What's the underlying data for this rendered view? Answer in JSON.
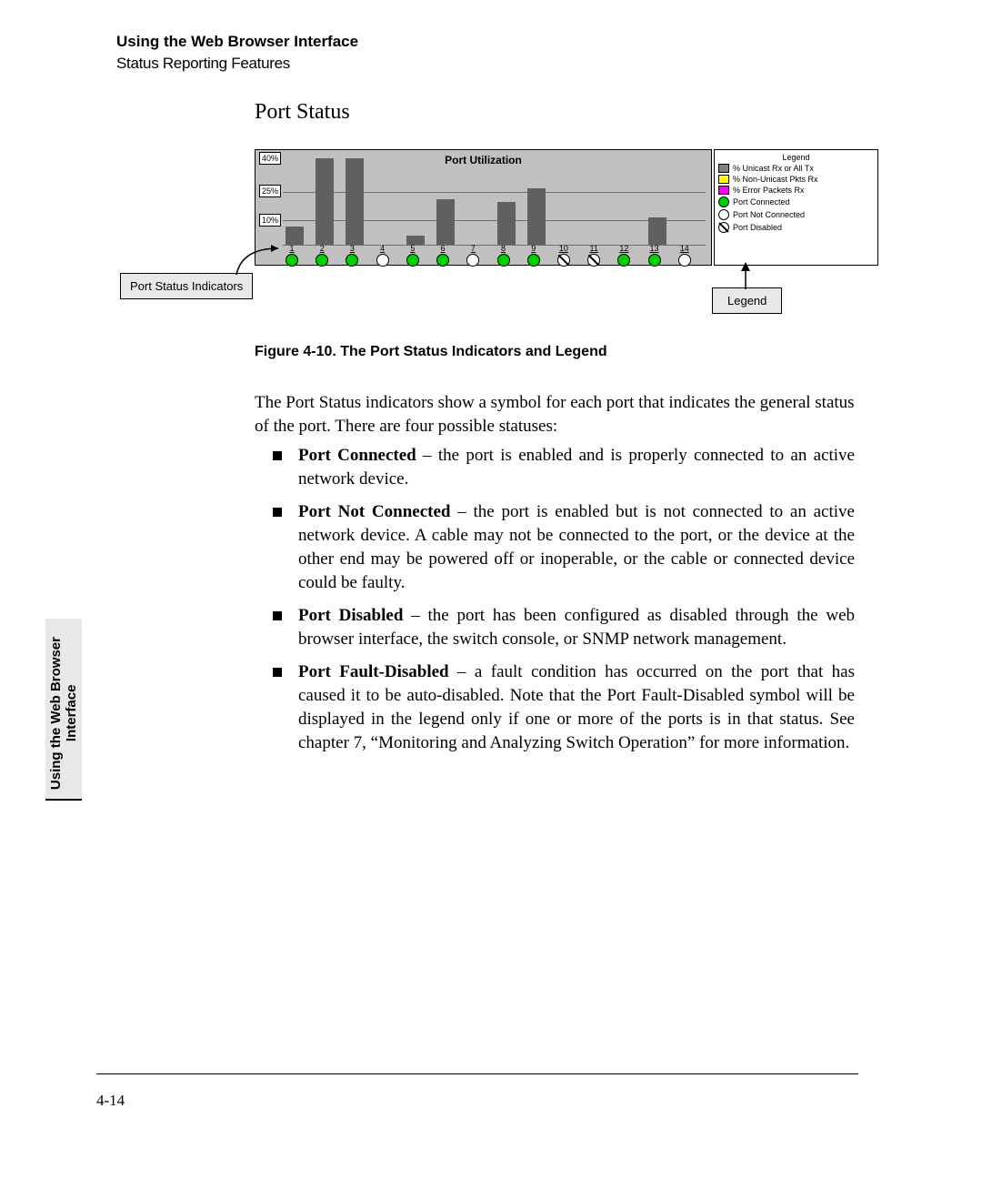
{
  "header": {
    "line1": "Using the Web Browser Interface",
    "line2": "Status Reporting Features"
  },
  "section_title": "Port Status",
  "figure": {
    "caption": "Figure 4-10.  The Port Status Indicators and Legend",
    "callout_left": "Port Status Indicators",
    "callout_right": "Legend"
  },
  "chart_data": {
    "type": "bar",
    "title": "Port Utilization",
    "y_ticks": [
      "40%",
      "25%",
      "10%"
    ],
    "ports": [
      1,
      2,
      3,
      4,
      5,
      6,
      7,
      8,
      9,
      10,
      11,
      12,
      13,
      14
    ],
    "values": [
      8,
      38,
      38,
      0,
      4,
      20,
      0,
      19,
      25,
      0,
      0,
      0,
      12,
      0
    ],
    "status": [
      "connected",
      "connected",
      "connected",
      "not",
      "connected",
      "connected",
      "not",
      "connected",
      "connected",
      "disabled",
      "disabled",
      "connected",
      "connected",
      "not"
    ],
    "legend": {
      "header": "Legend",
      "items": [
        {
          "kind": "sw",
          "cls": "gray",
          "label": "% Unicast Rx or All Tx"
        },
        {
          "kind": "sw",
          "cls": "yellow",
          "label": "% Non-Unicast Pkts Rx"
        },
        {
          "kind": "sw",
          "cls": "pink",
          "label": "% Error Packets Rx"
        },
        {
          "kind": "circ",
          "cls": "green",
          "label": "Port Connected"
        },
        {
          "kind": "circ",
          "cls": "white",
          "label": "Port Not Connected"
        },
        {
          "kind": "circ",
          "cls": "slash",
          "label": "Port Disabled"
        }
      ]
    }
  },
  "intro": "The Port Status indicators show a symbol for each port that indicates the general status of the port. There are four possible statuses:",
  "bullets": [
    {
      "term": "Port Connected",
      "desc": " – the port is enabled and is properly connected to an active network device."
    },
    {
      "term": "Port Not Connected",
      "desc": " – the port is enabled but is not connected to an active network device. A cable may not be connected to the port, or the device at the other end may be powered off or inoperable, or the cable or connected device could be faulty."
    },
    {
      "term": "Port Disabled",
      "desc": " – the port has been configured as disabled through the web browser interface, the switch console, or SNMP network manage­ment."
    },
    {
      "term": "Port Fault-Disabled",
      "desc": " – a fault condition has occurred on the port that has caused it to be auto-disabled. Note that the Port Fault-Disabled symbol will be displayed in the legend only if one or more of the ports is in that status. See chapter 7, “Monitoring and Analyzing Switch Operation” for more information."
    }
  ],
  "side_tab": "Using the Web Browser\nInterface",
  "page_number": "4-14"
}
